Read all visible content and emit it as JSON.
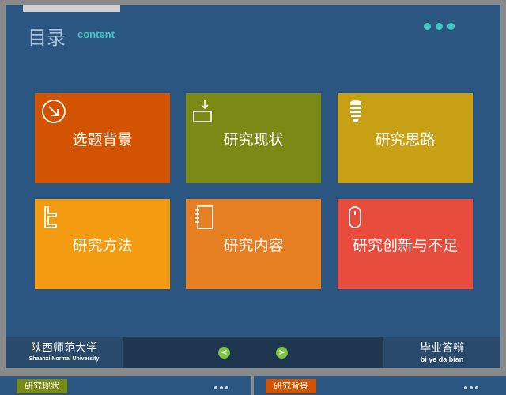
{
  "colors": {
    "background": "#2c5682",
    "accent_teal": "#3fc7c0",
    "nav_green": "#7dc242"
  },
  "header": {
    "title": "目录",
    "subtitle": "content"
  },
  "tiles": [
    {
      "label": "选题背景",
      "color": "#d35400",
      "icon": "arrow-circle-icon"
    },
    {
      "label": "研究现状",
      "color": "#7b8a14",
      "icon": "download-tray-icon"
    },
    {
      "label": "研究思路",
      "color": "#c8a013",
      "icon": "lightbulb-icon"
    },
    {
      "label": "研究方法",
      "color": "#f39c12",
      "icon": "tile-t-icon"
    },
    {
      "label": "研究内容",
      "color": "#e67e22",
      "icon": "notebook-icon"
    },
    {
      "label": "研究创新与不足",
      "color": "#e74c3c",
      "icon": "mouse-icon"
    }
  ],
  "footer": {
    "org_name": "陕西师范大学",
    "org_name_en": "Shaanxi Normal University",
    "defense_title": "毕业答辩",
    "defense_pinyin": "bi  ye da bian",
    "prev_symbol": "<",
    "next_symbol": ">"
  },
  "bottom_tabs": [
    {
      "label": "研究现状",
      "color": "#7b8a14"
    },
    {
      "label": "研究背景",
      "color": "#d35400"
    }
  ]
}
